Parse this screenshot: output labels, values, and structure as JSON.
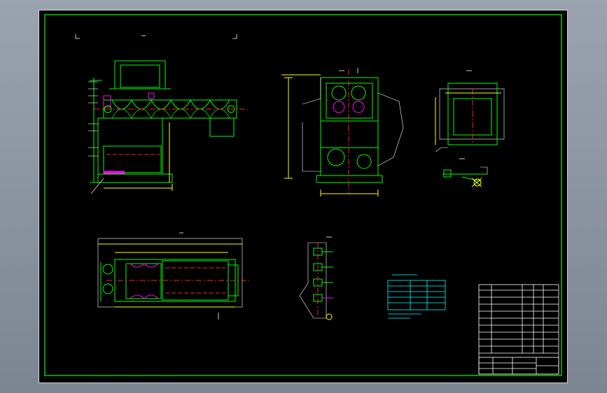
{
  "drawing": {
    "title_block_cells": [
      "",
      "",
      "",
      "",
      ""
    ],
    "notes_title": "",
    "colors": {
      "frame": "#00ff00",
      "detail_green": "#00ff00",
      "centerline_red": "#ff2020",
      "dimension_yellow": "#ffff00",
      "text_white": "#ffffff",
      "accent_magenta": "#ff00ff",
      "table_cyan": "#00ffff"
    }
  }
}
